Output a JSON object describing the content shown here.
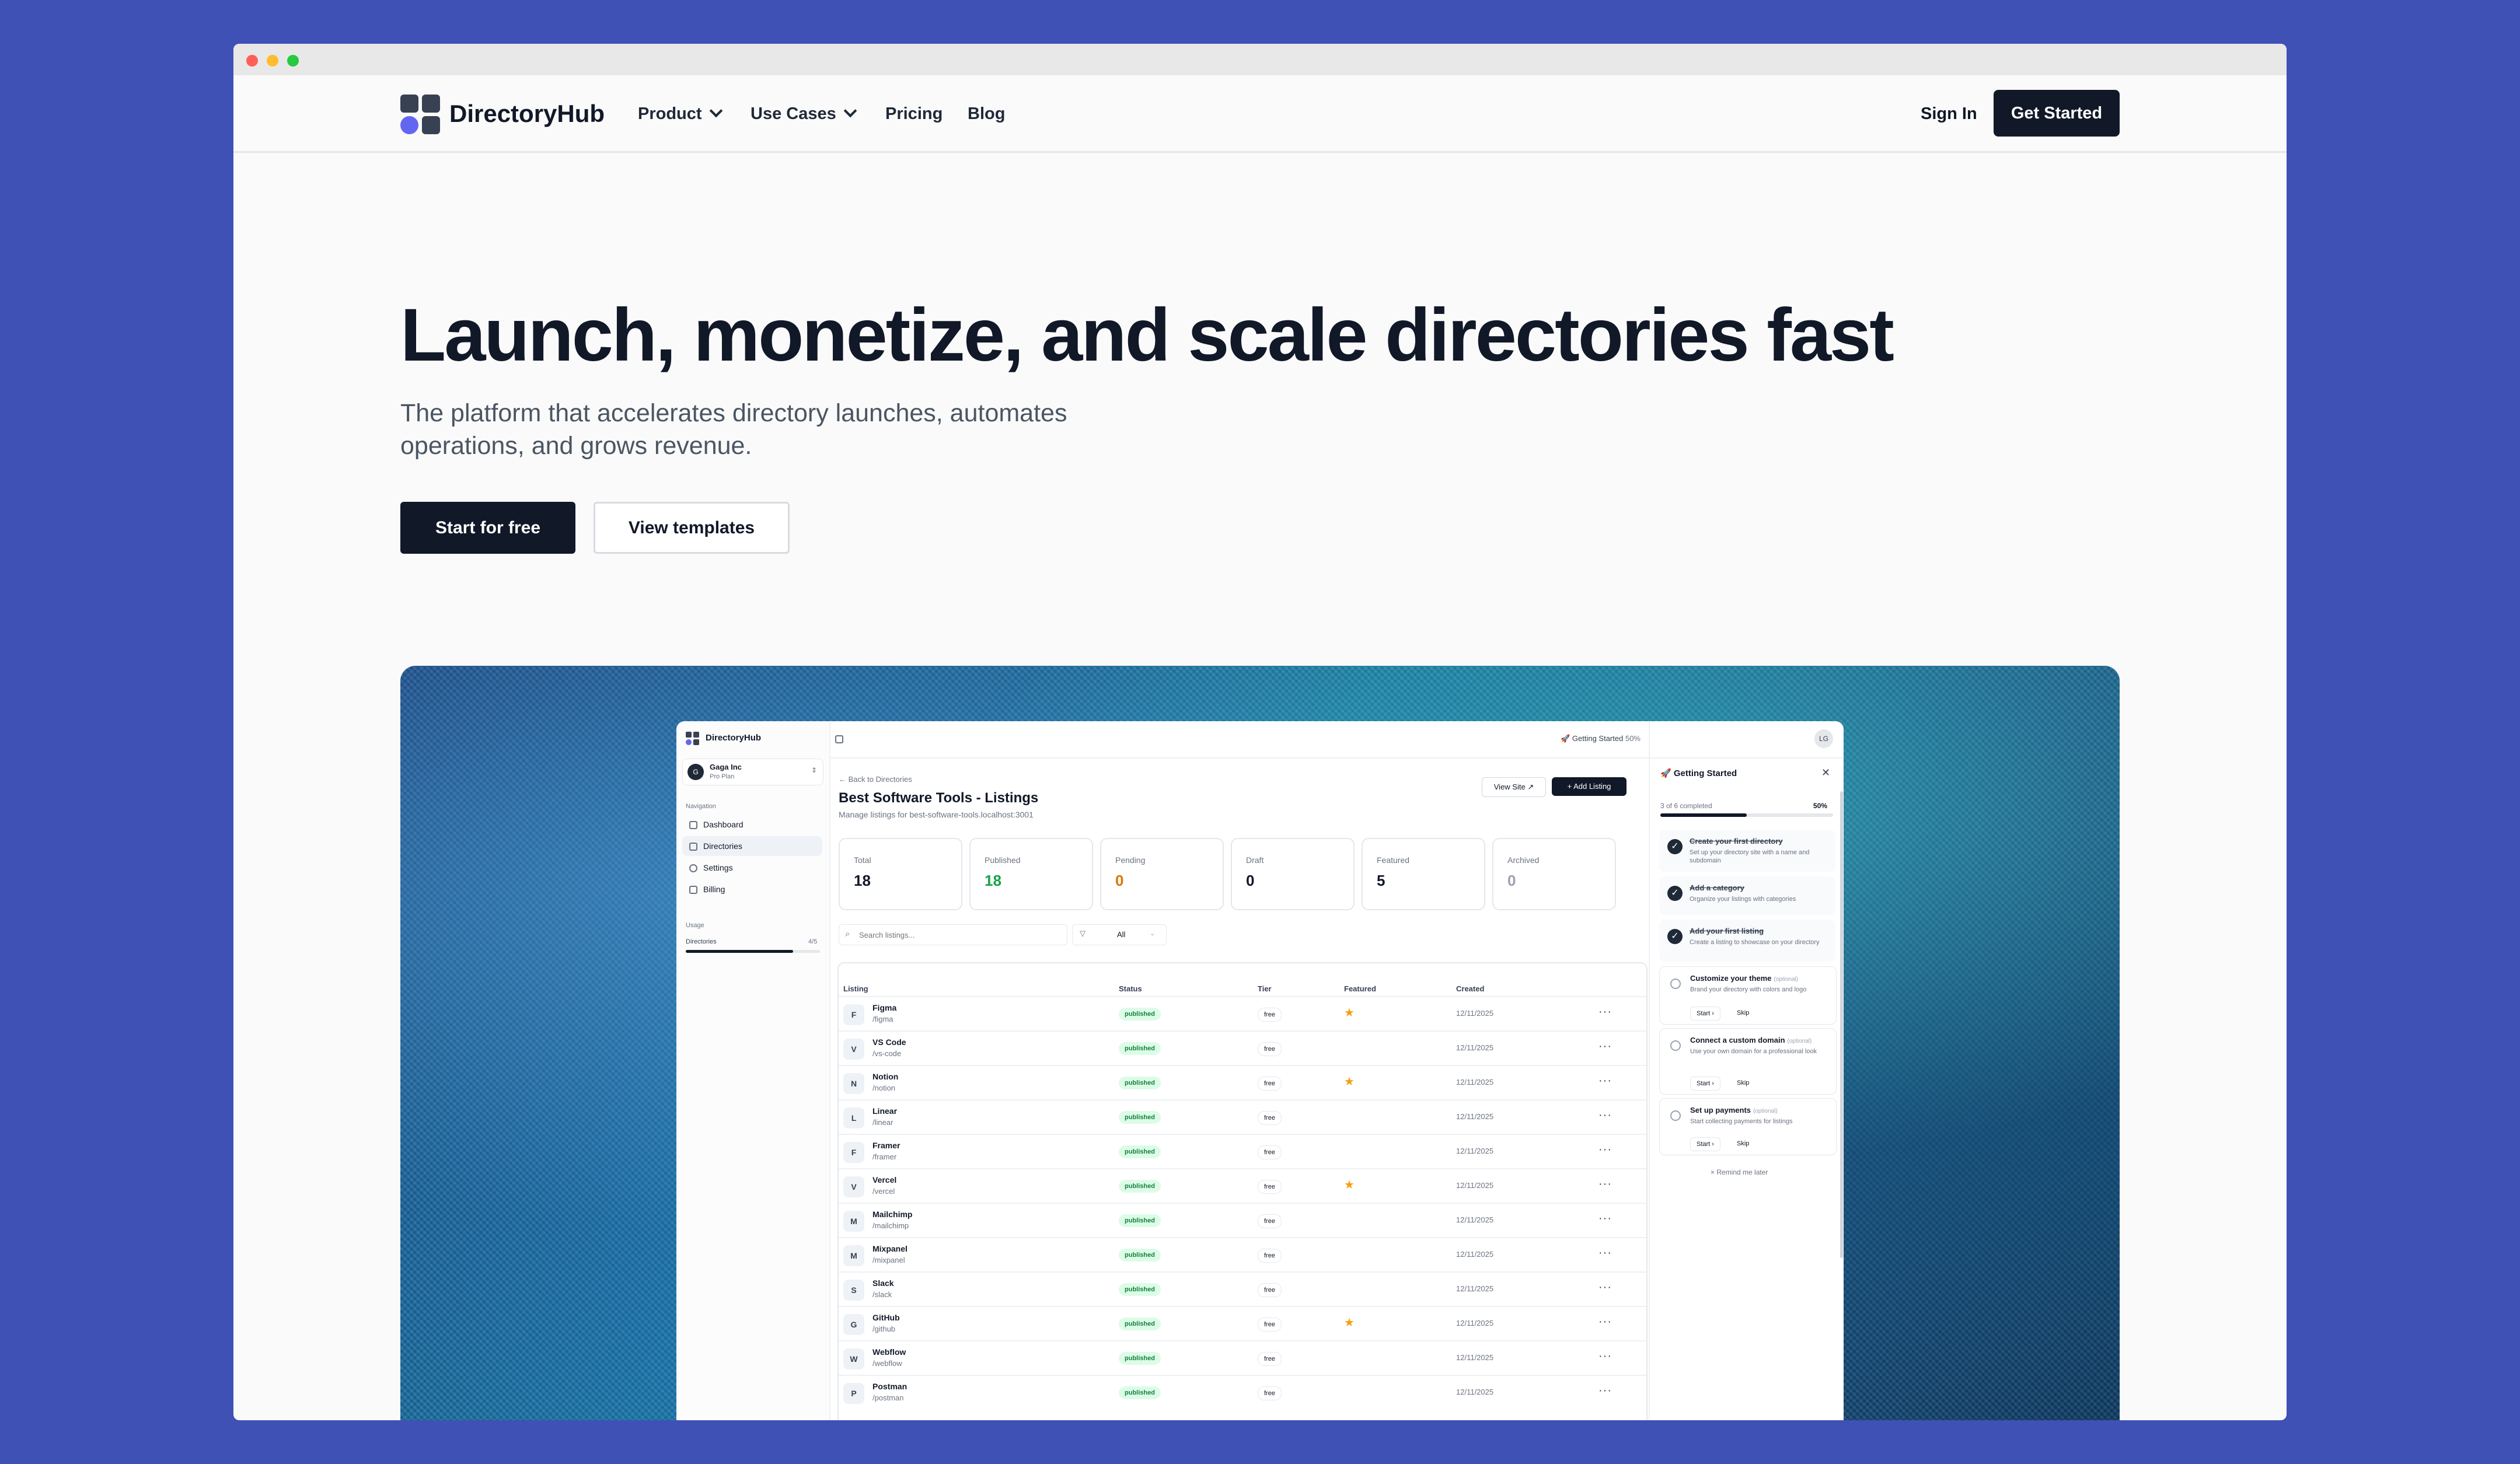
{
  "header": {
    "brand": "DirectoryHub",
    "nav": [
      {
        "label": "Product",
        "dropdown": true
      },
      {
        "label": "Use Cases",
        "dropdown": true
      },
      {
        "label": "Pricing"
      },
      {
        "label": "Blog"
      }
    ],
    "sign_in": "Sign In",
    "get_started": "Get Started"
  },
  "hero": {
    "title": "Launch, monetize, and scale directories fast",
    "subtitle": "The platform that accelerates directory launches, automates operations, and grows revenue.",
    "primary_cta": "Start for free",
    "secondary_cta": "View templates"
  },
  "app": {
    "brand": "DirectoryHub",
    "org": {
      "initial": "G",
      "name": "Gaga Inc",
      "plan": "Pro Plan"
    },
    "nav_heading": "Navigation",
    "nav": [
      "Dashboard",
      "Directories",
      "Settings",
      "Billing"
    ],
    "usage": {
      "heading": "Usage",
      "label": "Directories",
      "value": "4/5",
      "fraction": 0.8
    },
    "topbar": {
      "getting_started": "Getting Started",
      "percent": "50%",
      "avatar": "LG"
    },
    "back": "Back to Directories",
    "title": "Best Software Tools - Listings",
    "subtitle": "Manage listings for best-software-tools.localhost:3001",
    "view_site": "View Site",
    "add_listing": "Add Listing",
    "stats": [
      {
        "label": "Total",
        "value": "18",
        "color": "#111827"
      },
      {
        "label": "Published",
        "value": "18",
        "color": "#16a34a"
      },
      {
        "label": "Pending",
        "value": "0",
        "color": "#d97706"
      },
      {
        "label": "Draft",
        "value": "0",
        "color": "#111827"
      },
      {
        "label": "Featured",
        "value": "5",
        "color": "#111827"
      },
      {
        "label": "Archived",
        "value": "0",
        "color": "#9ca3af"
      }
    ],
    "search_placeholder": "Search listings...",
    "filter_value": "All",
    "columns": [
      "Listing",
      "Status",
      "Tier",
      "Featured",
      "Created"
    ],
    "listings": [
      {
        "initial": "F",
        "name": "Figma",
        "slug": "/figma",
        "status": "published",
        "tier": "free",
        "featured": true,
        "created": "12/11/2025"
      },
      {
        "initial": "V",
        "name": "VS Code",
        "slug": "/vs-code",
        "status": "published",
        "tier": "free",
        "featured": false,
        "created": "12/11/2025"
      },
      {
        "initial": "N",
        "name": "Notion",
        "slug": "/notion",
        "status": "published",
        "tier": "free",
        "featured": true,
        "created": "12/11/2025"
      },
      {
        "initial": "L",
        "name": "Linear",
        "slug": "/linear",
        "status": "published",
        "tier": "free",
        "featured": false,
        "created": "12/11/2025"
      },
      {
        "initial": "F",
        "name": "Framer",
        "slug": "/framer",
        "status": "published",
        "tier": "free",
        "featured": false,
        "created": "12/11/2025"
      },
      {
        "initial": "V",
        "name": "Vercel",
        "slug": "/vercel",
        "status": "published",
        "tier": "free",
        "featured": true,
        "created": "12/11/2025"
      },
      {
        "initial": "M",
        "name": "Mailchimp",
        "slug": "/mailchimp",
        "status": "published",
        "tier": "free",
        "featured": false,
        "created": "12/11/2025"
      },
      {
        "initial": "M",
        "name": "Mixpanel",
        "slug": "/mixpanel",
        "status": "published",
        "tier": "free",
        "featured": false,
        "created": "12/11/2025"
      },
      {
        "initial": "S",
        "name": "Slack",
        "slug": "/slack",
        "status": "published",
        "tier": "free",
        "featured": false,
        "created": "12/11/2025"
      },
      {
        "initial": "G",
        "name": "GitHub",
        "slug": "/github",
        "status": "published",
        "tier": "free",
        "featured": true,
        "created": "12/11/2025"
      },
      {
        "initial": "W",
        "name": "Webflow",
        "slug": "/webflow",
        "status": "published",
        "tier": "free",
        "featured": false,
        "created": "12/11/2025"
      },
      {
        "initial": "P",
        "name": "Postman",
        "slug": "/postman",
        "status": "published",
        "tier": "free",
        "featured": false,
        "created": "12/11/2025"
      }
    ],
    "panel": {
      "title": "Getting Started",
      "progress_text": "3 of 6 completed",
      "progress_percent": "50%",
      "progress_fraction": 0.5,
      "tasks": [
        {
          "title": "Create your first directory",
          "desc": "Set up your directory site with a name and subdomain",
          "done": true
        },
        {
          "title": "Add a category",
          "desc": "Organize your listings with categories",
          "done": true
        },
        {
          "title": "Add your first listing",
          "desc": "Create a listing to showcase on your directory",
          "done": true
        },
        {
          "title": "Customize your theme",
          "optional": "(optional)",
          "desc": "Brand your directory with colors and logo",
          "done": false,
          "start": "Start",
          "skip": "Skip"
        },
        {
          "title": "Connect a custom domain",
          "optional": "(optional)",
          "desc": "Use your own domain for a professional look",
          "done": false,
          "start": "Start",
          "skip": "Skip"
        },
        {
          "title": "Set up payments",
          "optional": "(optional)",
          "desc": "Start collecting payments for listings",
          "done": false,
          "start": "Start",
          "skip": "Skip"
        }
      ],
      "remind": "Remind me later"
    }
  }
}
